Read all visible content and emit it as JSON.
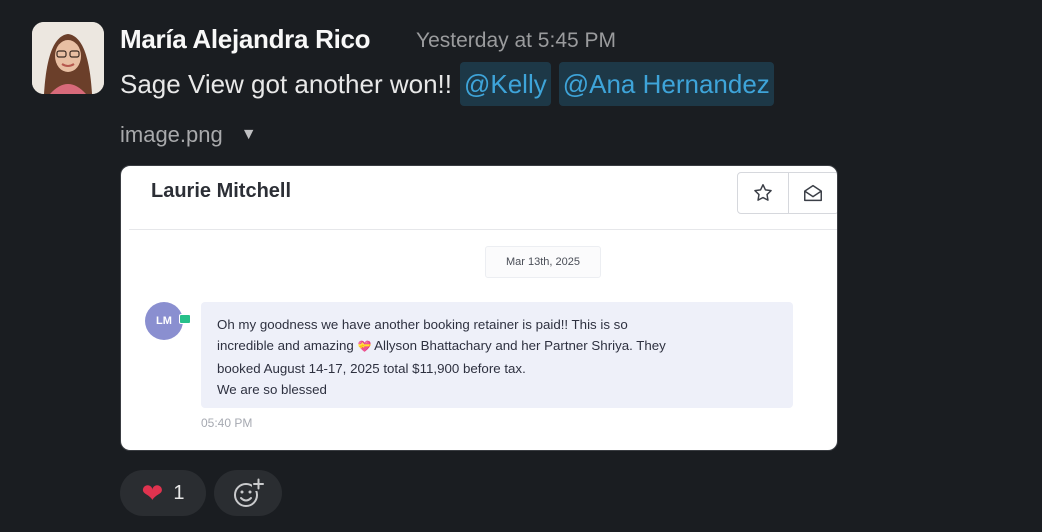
{
  "message": {
    "sender": "María Alejandra Rico",
    "timestamp": "Yesterday at 5:45 PM",
    "text": "Sage View got another won!!",
    "mentions": [
      "@Kelly",
      "@Ana Hernandez"
    ],
    "attachment": {
      "filename": "image.png",
      "caret_icon": "chevron-down-icon",
      "screenshot": {
        "contact_name": "Laurie Mitchell",
        "toolbar_icons": [
          "star-icon",
          "envelope-open-icon"
        ],
        "date_chip": "Mar 13th, 2025",
        "avatar_initials": "LM",
        "body_lines": [
          "Oh my goodness we have another booking retainer is paid!! This is so",
          "incredible and amazing",
          "Allyson Bhattachary and her Partner Shriya. They",
          "booked August 14-17, 2025 total $11,900 before tax.",
          "We are so blessed"
        ],
        "sent_time": "05:40 PM"
      }
    }
  },
  "reactions": [
    {
      "emoji": "❤️",
      "icon": "heart-icon",
      "count": "1"
    }
  ],
  "add_reaction_icon": "add-reaction-icon",
  "colors": {
    "background": "#1a1d21",
    "mention_text": "#3ea4d9",
    "mention_bg": "#1d3847",
    "reaction_bg": "#2a2d31"
  }
}
